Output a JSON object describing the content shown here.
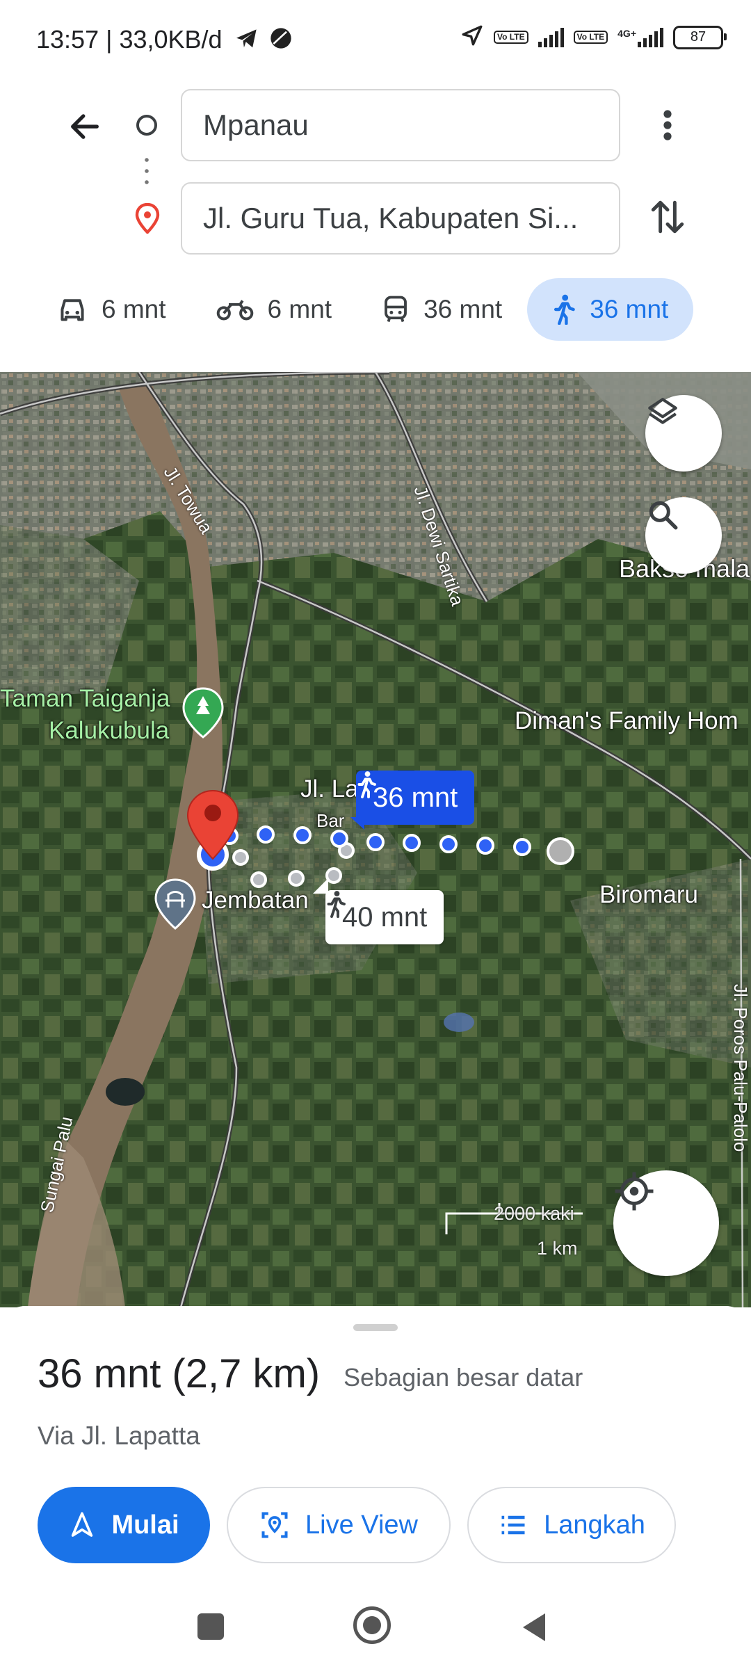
{
  "status_bar": {
    "time": "13:57",
    "net_speed": "33,0KB/d",
    "volte": "Vo LTE",
    "network_type": "4G+",
    "battery": "87"
  },
  "header": {
    "origin": "Mpanau",
    "destination": "Jl. Guru Tua, Kabupaten Si..."
  },
  "modes": [
    {
      "icon": "car-icon",
      "label": "6 mnt"
    },
    {
      "icon": "motorcycle-icon",
      "label": "6 mnt"
    },
    {
      "icon": "transit-icon",
      "label": "36 mnt"
    },
    {
      "icon": "walk-icon",
      "label": "36 mnt",
      "active": true
    }
  ],
  "map": {
    "labels": {
      "towua": "Jl. Towua",
      "dewi_sartika": "Jl. Dewi Sartika",
      "bakso": "Bakso mala dan mie aya",
      "taman_1": "Taman Taiganja",
      "taman_2": "Kalukubula",
      "dimans": "Diman's Family Hom",
      "jl_la": "Jl. La",
      "bar": "Bar",
      "jembatan": "Jembatan",
      "biromaru": "Biromaru",
      "poros": "Jl. Poros Palu-Palolo",
      "sungai": "Sungai Palu"
    },
    "route_main": "36 mnt",
    "route_alt": "40 mnt",
    "scale_ft": "2000 kaki",
    "scale_km": "1 km"
  },
  "sheet": {
    "summary": "36 mnt (2,7 km)",
    "terrain": "Sebagian besar datar",
    "via": "Via Jl. Lapatta",
    "start": "Mulai",
    "live_view": "Live View",
    "steps": "Langkah"
  },
  "colors": {
    "accent": "#1a73e8",
    "active_mode_bg": "#d2e3fc",
    "pin": "#ea4335",
    "route": "#2f62f5"
  }
}
